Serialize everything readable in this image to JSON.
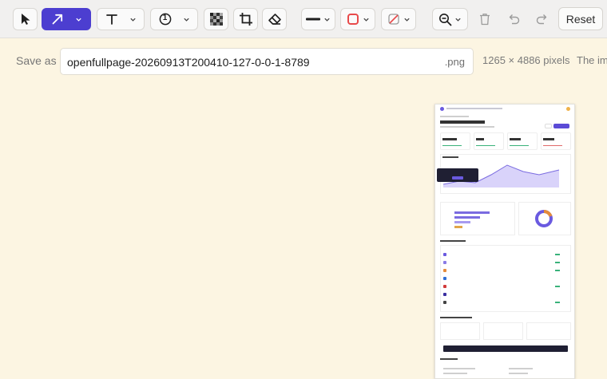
{
  "toolbar": {
    "tools": [
      {
        "id": "select",
        "icon": "cursor-icon"
      },
      {
        "id": "arrow",
        "icon": "arrow-icon",
        "active": true
      },
      {
        "id": "text",
        "icon": "text-icon"
      },
      {
        "id": "number",
        "icon": "numbered-marker-icon",
        "marker_text": "1"
      },
      {
        "id": "pixelate",
        "icon": "pixelate-icon"
      },
      {
        "id": "crop",
        "icon": "crop-icon"
      },
      {
        "id": "eraser",
        "icon": "eraser-icon"
      },
      {
        "id": "stroke",
        "icon": "stroke-width-icon"
      },
      {
        "id": "stroke-color",
        "icon": "stroke-color-icon",
        "color": "#e8494a"
      },
      {
        "id": "fill-color",
        "icon": "no-fill-icon",
        "color": "#e8494a"
      },
      {
        "id": "zoom",
        "icon": "zoom-out-icon"
      },
      {
        "id": "delete",
        "icon": "trash-icon"
      },
      {
        "id": "undo",
        "icon": "undo-icon"
      },
      {
        "id": "redo",
        "icon": "redo-icon"
      }
    ],
    "reset_label": "Reset",
    "accent_color": "#4c3ed0"
  },
  "save": {
    "label": "Save as",
    "filename": "openfullpage-20260913T200410-127-0-0-1-8789",
    "extension": ".png"
  },
  "image_info": {
    "dimensions": "1265 × 4886 pixels",
    "hint_text": "The im"
  },
  "preview": {
    "icon": "screenshot-thumbnail"
  }
}
